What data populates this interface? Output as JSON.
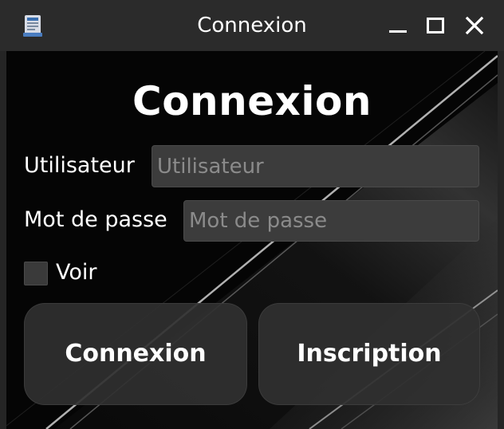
{
  "window": {
    "title": "Connexion",
    "controls": [
      "minimize-icon",
      "maximize-icon",
      "close-icon"
    ]
  },
  "form": {
    "heading": "Connexion",
    "username_label": "Utilisateur",
    "username_value": "",
    "username_placeholder": "Utilisateur",
    "password_label": "Mot de passe",
    "password_value": "",
    "password_placeholder": "Mot de passe",
    "show_password_label": "Voir",
    "show_password_checked": false,
    "login_button": "Connexion",
    "register_button": "Inscription"
  },
  "colors": {
    "background": "#050505",
    "titlebar": "#2b2b2b",
    "field": "#3c3c3c",
    "button": "#303030",
    "text": "#ffffff",
    "placeholder": "#8b8b8b"
  }
}
